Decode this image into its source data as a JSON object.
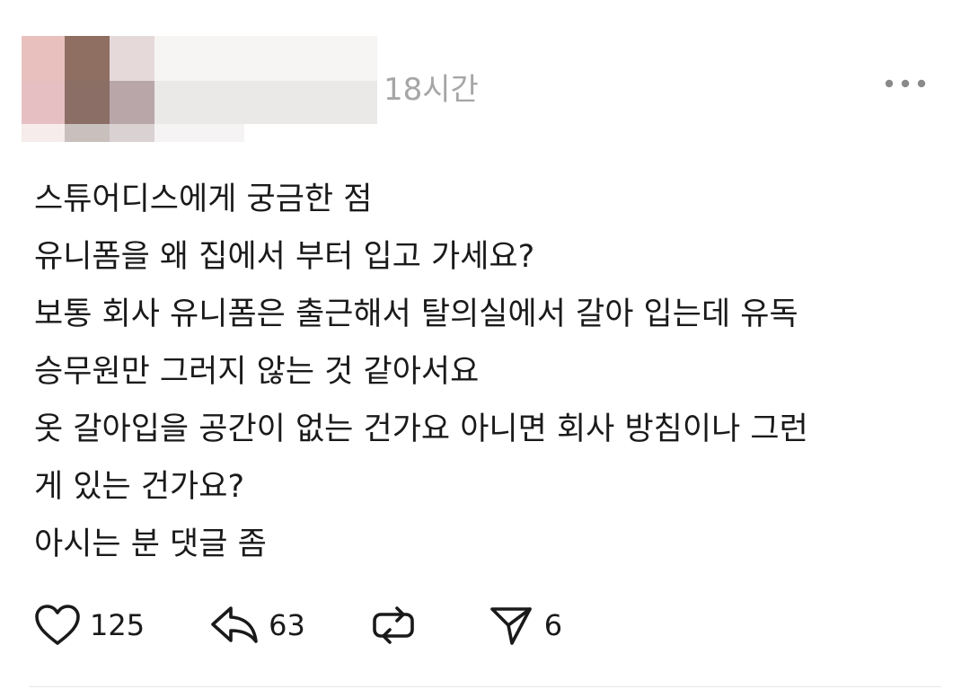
{
  "post": {
    "timestamp": "18시간",
    "body_lines": [
      "스튜어디스에게 궁금한 점",
      "유니폼을 왜 집에서 부터 입고 가세요?",
      "보통 회사 유니폼은 출근해서 탈의실에서 갈아 입는데 유독",
      "승무원만 그러지 않는 것 같아서요",
      "옷 갈아입을 공간이 없는 건가요 아니면 회사 방침이나 그런",
      "게 있는 건가요?",
      "아시는 분 댓글 좀"
    ],
    "actions": {
      "like": {
        "icon": "heart-icon",
        "count": "125"
      },
      "reply": {
        "icon": "reply-arrow-icon",
        "count": "63"
      },
      "repost": {
        "icon": "repost-icon",
        "count": ""
      },
      "share": {
        "icon": "send-icon",
        "count": "6"
      }
    },
    "colors": {
      "text": "#1a1a1a",
      "muted": "#a6a6a6",
      "background": "#ffffff"
    }
  }
}
